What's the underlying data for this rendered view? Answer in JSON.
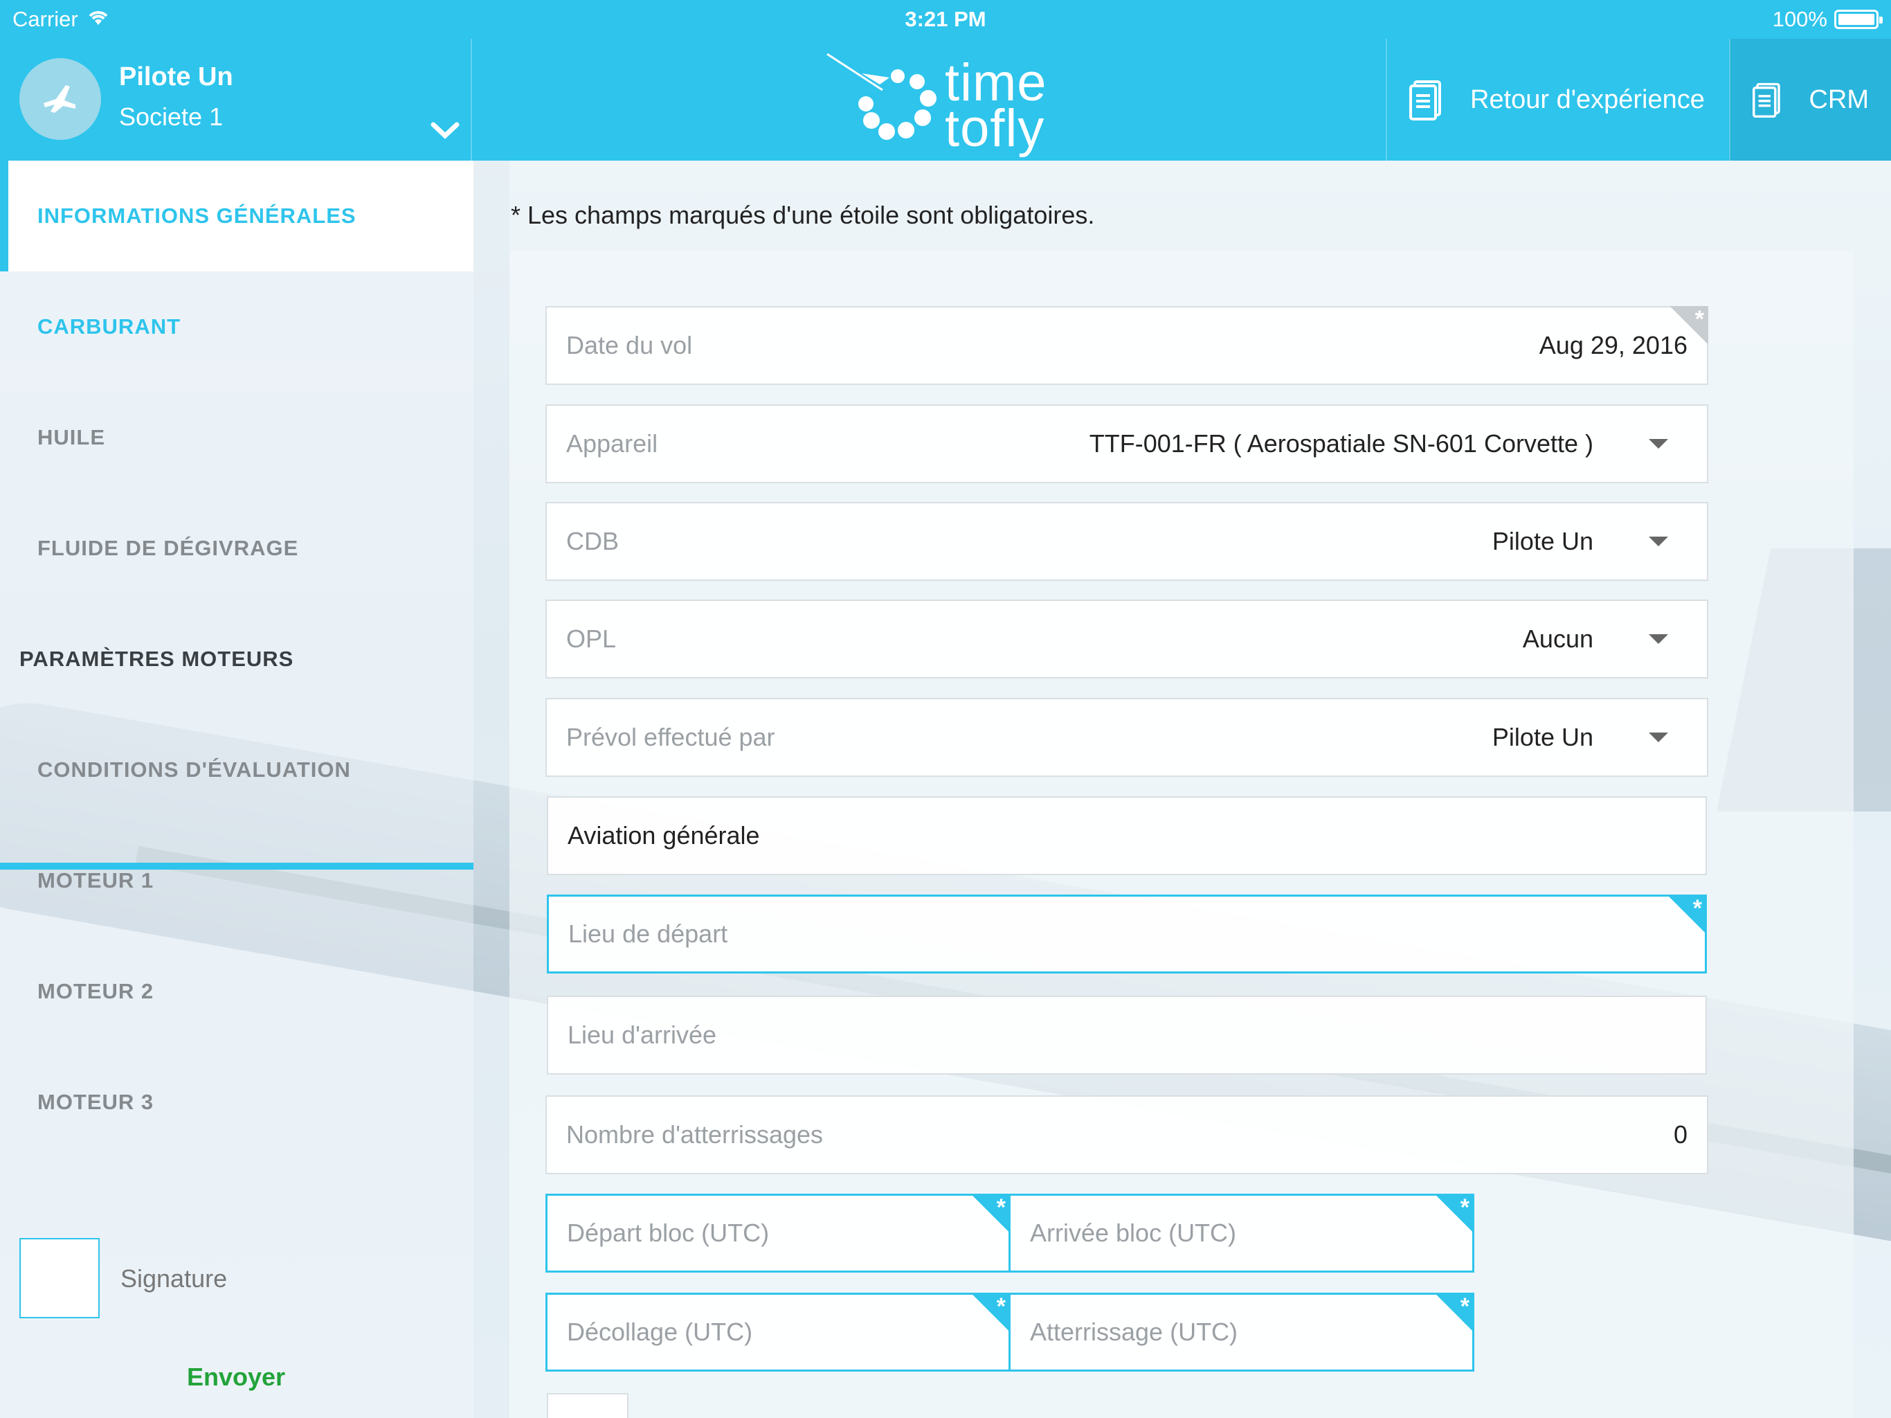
{
  "status_bar": {
    "carrier": "Carrier",
    "time": "3:21 PM",
    "battery": "100%"
  },
  "header": {
    "user_name": "Pilote Un",
    "company": "Societe 1",
    "logo_line1": "time",
    "logo_line2": "tofly",
    "retex_label": "Retour d'expérience",
    "crm_label": "CRM"
  },
  "sidebar": {
    "items": [
      {
        "label": "INFORMATIONS GÉNÉRALES"
      },
      {
        "label": "CARBURANT"
      },
      {
        "label": "HUILE"
      },
      {
        "label": "FLUIDE DE DÉGIVRAGE"
      },
      {
        "label": "PARAMÈTRES MOTEURS"
      },
      {
        "label": "CONDITIONS D'ÉVALUATION"
      },
      {
        "label": "MOTEUR 1"
      },
      {
        "label": "MOTEUR 2"
      },
      {
        "label": "MOTEUR 3"
      }
    ],
    "signature_label": "Signature",
    "send_label": "Envoyer"
  },
  "form": {
    "note": "* Les champs marqués d'une étoile sont obligatoires.",
    "date_label": "Date du vol",
    "date_value": "Aug 29, 2016",
    "aircraft_label": "Appareil",
    "aircraft_value": "TTF-001-FR ( Aerospatiale SN-601 Corvette )",
    "cdb_label": "CDB",
    "cdb_value": "Pilote Un",
    "opl_label": "OPL",
    "opl_value": "Aucun",
    "preflight_label": "Prévol effectué par",
    "preflight_value": "Pilote Un",
    "category_value": "Aviation générale",
    "departure_place_placeholder": "Lieu de départ",
    "arrival_place_placeholder": "Lieu d'arrivée",
    "landings_label": "Nombre d'atterrissages",
    "landings_value": "0",
    "block_departure_placeholder": "Départ bloc (UTC)",
    "block_arrival_placeholder": "Arrivée bloc (UTC)",
    "takeoff_placeholder": "Décollage (UTC)",
    "landing_placeholder": "Atterrissage (UTC)",
    "required_mark": "*"
  },
  "colors": {
    "accent": "#2ec4ec",
    "send": "#22a33a"
  }
}
